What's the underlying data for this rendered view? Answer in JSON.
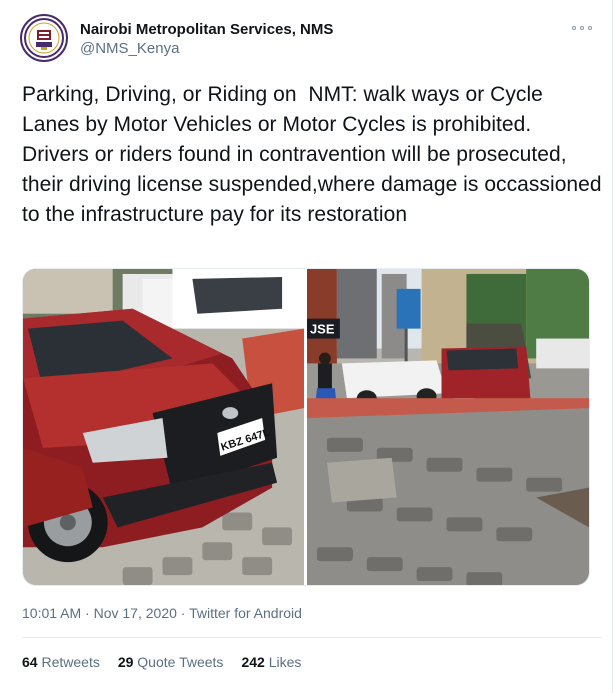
{
  "author": {
    "display_name": "Nairobi Metropolitan Services, NMS",
    "handle": "@NMS_Kenya",
    "avatar_icon": "nms-logo-icon"
  },
  "more_icon": "more-dots-icon",
  "tweet": {
    "text": "Parking, Driving, or Riding on  NMT: walk ways or Cycle Lanes by Motor Vehicles or Motor Cycles is prohibited. Drivers or riders found in contravention will be prosecuted, their driving license suspended,where damage is occassioned to the infrastructure pay for its restoration"
  },
  "media": {
    "left_plate": "KBZ 647L",
    "right_sign": "JSE"
  },
  "meta": {
    "time": "10:01 AM",
    "sep1": " · ",
    "date": "Nov 17, 2020",
    "sep2": " · ",
    "source": "Twitter for Android"
  },
  "stats": {
    "retweets_count": "64",
    "retweets_label": "Retweets",
    "quotes_count": "29",
    "quotes_label": "Quote Tweets",
    "likes_count": "242",
    "likes_label": "Likes"
  },
  "colors": {
    "text": "#0f1419",
    "secondary": "#5b7083",
    "border": "#e6ecf0",
    "avatar_ring": "#4a2a6f"
  }
}
